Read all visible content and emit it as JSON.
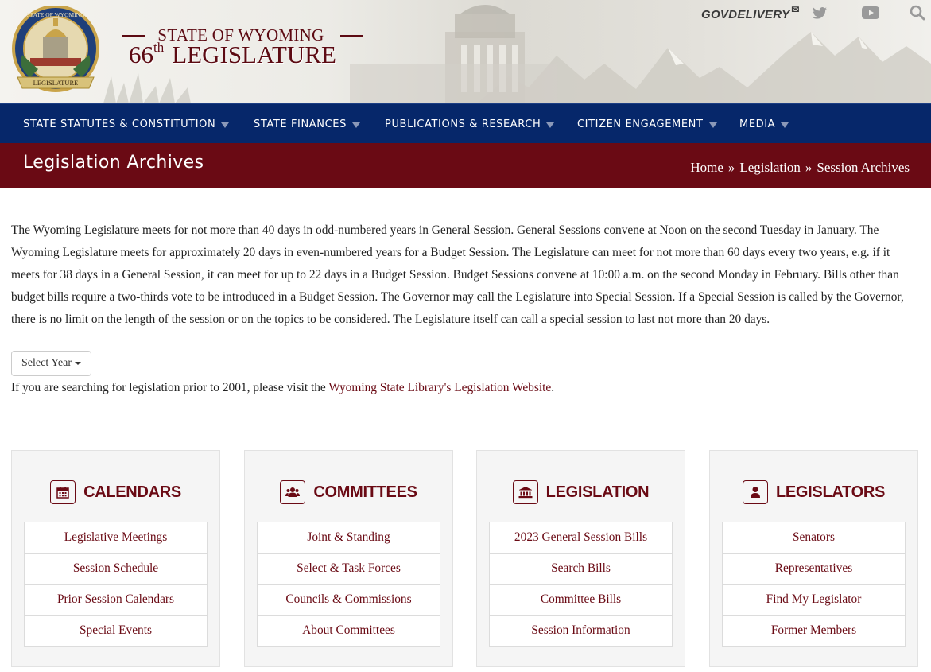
{
  "header": {
    "seal_text": "STATE OF WYOMING",
    "seal_banner": "LEGISLATURE",
    "title_line1": "STATE OF WYOMING",
    "title_number": "66",
    "title_suffix": "th",
    "title_line2": "LEGISLATURE",
    "govdelivery_label": "GOVDELIVERY",
    "icons": [
      "envelope-icon",
      "twitter-icon",
      "youtube-icon",
      "search-icon"
    ]
  },
  "nav": {
    "items": [
      {
        "label": "STATE STATUTES & CONSTITUTION"
      },
      {
        "label": "STATE FINANCES"
      },
      {
        "label": "PUBLICATIONS & RESEARCH"
      },
      {
        "label": "CITIZEN ENGAGEMENT"
      },
      {
        "label": "MEDIA"
      }
    ]
  },
  "titlebar": {
    "title": "Legislation Archives",
    "breadcrumb": [
      "Home",
      "Legislation",
      "Session Archives"
    ],
    "separator": "»"
  },
  "intro": {
    "paragraph": "The Wyoming Legislature meets for not more than 40 days in odd-numbered years in General Session. General Sessions convene at Noon on the second Tuesday in January. The Wyoming Legislature meets for approximately 20 days in even-numbered years for a Budget Session. The Legislature can meet for not more than 60 days every two years, e.g. if it meets for 38 days in a General Session, it can meet for up to 22 days in a Budget Session. Budget Sessions convene at 10:00 a.m. on the second Monday in February. Bills other than budget bills require a two-thirds vote to be introduced in a Budget Session. The Governor may call the Legislature into Special Session. If a Special Session is called by the Governor, there is no limit on the length of the session or on the topics to be considered. The Legislature itself can call a special session to last not more than 20 days.",
    "select_year_label": "Select Year",
    "prior_text": "If you are searching for legislation prior to 2001, please visit the",
    "prior_link": "Wyoming State Library's Legislation Website",
    "prior_end": "."
  },
  "cards": [
    {
      "title": "CALENDARS",
      "icon": "calendar-icon",
      "links": [
        "Legislative Meetings",
        "Session Schedule",
        "Prior Session Calendars",
        "Special Events"
      ]
    },
    {
      "title": "COMMITTEES",
      "icon": "users-icon",
      "links": [
        "Joint & Standing",
        "Select & Task Forces",
        "Councils & Commissions",
        "About Committees"
      ]
    },
    {
      "title": "LEGISLATION",
      "icon": "capitol-building-icon",
      "links": [
        "2023 General Session Bills",
        "Search Bills",
        "Committee Bills",
        "Session Information"
      ]
    },
    {
      "title": "LEGISLATORS",
      "icon": "user-icon",
      "links": [
        "Senators",
        "Representatives",
        "Find My Legislator",
        "Former Members"
      ]
    }
  ],
  "colors": {
    "nav_bg": "#06276a",
    "titlebar_bg": "#6a0a14",
    "accent_maroon": "#6a0a14",
    "card_bg": "#f5f5f5"
  }
}
